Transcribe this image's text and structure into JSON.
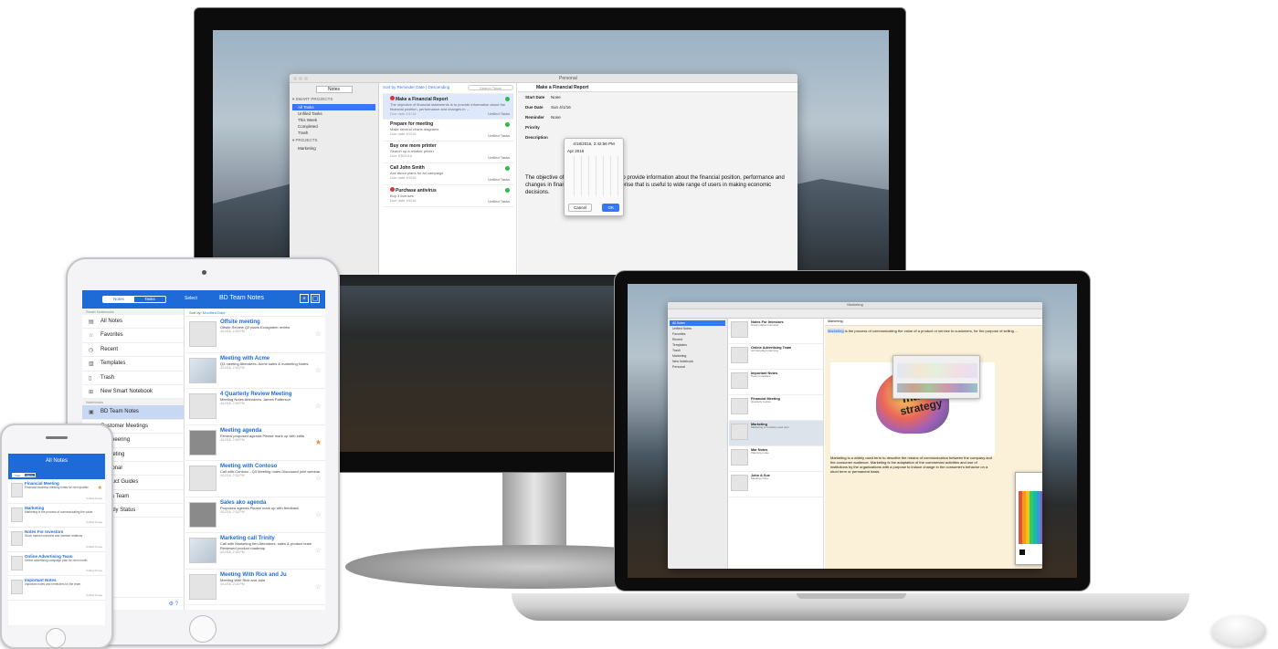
{
  "desktop": {
    "window_title": "Personal",
    "sidebar": {
      "seg_label": "Notes",
      "smart_group": "▾ SMART PROJECTS",
      "smart_items": [
        "All Tasks",
        "Unfiled Tasks",
        "This Week",
        "Completed",
        "Trash"
      ],
      "projects_group": "▾ PROJECTS",
      "project_items": [
        "Marketing"
      ]
    },
    "toolbar": {
      "sort_label": "Sort by Reminder Date",
      "order_label": "Descending",
      "search_placeholder": "Search Tasks"
    },
    "tasks": [
      {
        "title": "Make a Financial Report",
        "desc": "The objective of financial statements is to provide information about the financial position, performance and changes in ...",
        "note": "Due date 4/1/16",
        "project": "Unfiled Tasks"
      },
      {
        "title": "Prepare for meeting",
        "desc": "Make several charts diagrams",
        "note": "Due date 4/2/16",
        "project": "Unfiled Tasks"
      },
      {
        "title": "Buy one more printer",
        "desc": "Search up a reliable printer",
        "note": "Due 4/5/2016",
        "project": "Unfiled Tasks"
      },
      {
        "title": "Call John Smith",
        "desc": "Ask about plans for ad campaign",
        "note": "Due date 4/5/16",
        "project": "Unfiled Tasks"
      },
      {
        "title": "Purchase antivirus",
        "desc": "Buy 3 licenses",
        "note": "Due date 4/6/16",
        "project": "Unfiled Tasks"
      }
    ],
    "detail": {
      "title": "Make a Financial Report",
      "fields": [
        {
          "label": "Start Date",
          "value": "None"
        },
        {
          "label": "Due Date",
          "value": "Sun 4/1/16"
        },
        {
          "label": "Reminder",
          "value": "None"
        },
        {
          "label": "Priority",
          "value": ""
        },
        {
          "label": "Description",
          "value": ""
        }
      ],
      "description": "The objective of financial statements is to provide information about the financial position, performance and changes in financial position of an enterprise that is useful to wide range of users in making economic decisions."
    },
    "date_picker": {
      "datetime": "4/18/2016, 2:42:56 PM",
      "month": "Apr 2016",
      "cancel": "Cancel",
      "ok": "OK"
    }
  },
  "tablet": {
    "seg": [
      "Notes",
      "Tasks"
    ],
    "select_label": "Select",
    "title": "BD Team Notes",
    "section_smart": "Smart Notebooks",
    "smart_items": [
      "All Notes",
      "Favorites",
      "Recent",
      "Templates",
      "Trash",
      "New Smart Notebook"
    ],
    "section_notebooks": "Notebooks",
    "notebook_items": [
      "BD Team Notes",
      "Customer Meetings",
      "Engineering",
      "Marketing",
      "Personal",
      "Product Guides",
      "Sales Team",
      "Weekly Status"
    ],
    "sort_prefix": "Sort by:",
    "sort_value": "Modified Date",
    "notes": [
      {
        "title": "Offsite meeting",
        "body": "Offsite\nReview Q2 plans\nEcosystem review",
        "date": "4/12/16, 2:18 PM"
      },
      {
        "title": "Meeting with Acme",
        "body": "Q3 meeting\nAttendees: Acme sales & marketing\nNotes:",
        "date": "4/12/16, 2:18 PM"
      },
      {
        "title": "4 Quarterly Review Meeting",
        "body": "Meeting Notes\nAttendees:\nJames Patterson",
        "date": "4/12/16, 2:18 PM"
      },
      {
        "title": "Meeting agenda",
        "body": "Review proposed agenda\nPlease mark up with edits",
        "date": "4/12/16, 2:18 PM"
      },
      {
        "title": "Meeting with Contoso",
        "body": "Call with Contoso - Q3\nMeeting notes\nDiscussed joint webinar",
        "date": "4/12/16, 2:18 PM"
      },
      {
        "title": "Sales ako agenda",
        "body": "Proposed agenda\nPlease mark up with feedback",
        "date": "4/12/16, 2:18 PM"
      },
      {
        "title": "Marketing call Trinity",
        "body": "Call with Marketing firm\nAttendees: sales & product team\nReviewed product roadmap",
        "date": "4/12/16, 2:18 PM"
      },
      {
        "title": "Meeting With Rick and Ju",
        "body": "Meeting\nWith Rick and Julie",
        "date": "4/12/16, 2:18 PM"
      }
    ]
  },
  "phone": {
    "title": "All Notes",
    "seg": [
      "Date",
      "Name"
    ],
    "notes": [
      {
        "title": "Financial Meeting",
        "body": "Financial business meeting notes for next quarter",
        "tag": "Unfiled Notes"
      },
      {
        "title": "Marketing",
        "body": "Marketing is the process of communicating the value",
        "tag": "Unfiled Notes"
      },
      {
        "title": "Notes For Investors",
        "body": "Stock market overview and investor relations",
        "tag": "Unfiled Notes"
      },
      {
        "title": "Online Advertising Team",
        "body": "Online advertising campaign plan for next month",
        "tag": "Unfiled Notes"
      },
      {
        "title": "Important Notes",
        "body": "Important notes and reminders for the team",
        "tag": "Unfiled Notes"
      }
    ]
  },
  "laptop": {
    "window_title": "Marketing",
    "sidebar_items": [
      "All Notes",
      "Unfiled Notes",
      "Favorites",
      "Recent",
      "Templates",
      "Trash",
      "Marketing",
      "New Notebook",
      "Personal"
    ],
    "notes": [
      {
        "title": "Notes For Investors",
        "body": "Stock market overview"
      },
      {
        "title": "Online Advertising Team",
        "body": "Ad campaign planning"
      },
      {
        "title": "Important Notes",
        "body": "Team reminders"
      },
      {
        "title": "Financial Meeting",
        "body": "Quarterly review"
      },
      {
        "title": "Marketing",
        "body": "Marketing is a widely used term"
      },
      {
        "title": "Mar Notes",
        "body": "Planning notes"
      },
      {
        "title": "John & Sue",
        "body": "Meeting notes"
      }
    ],
    "editor_title": "Marketing",
    "intro_highlight": "Marketing",
    "intro_rest": " is the process of communicating the value of a product or service to customers, for the purpose of selling ...",
    "image_words": [
      "marketing",
      "strategy"
    ],
    "body": "Marketing is a widely used term to describe the means of communication between the company and the consumer audience. Marketing is the adaptation of the commercial activities and use of institutions by the organizations with a purpose to induce change in the consumer's behavior on a short term or permanent basis."
  }
}
